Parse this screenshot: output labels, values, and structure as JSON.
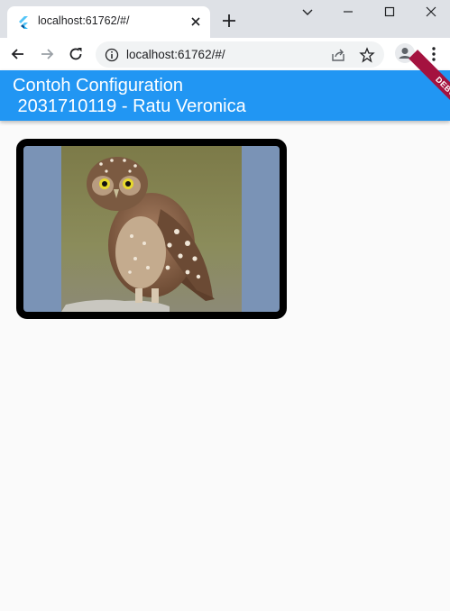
{
  "browser": {
    "tab_title": "localhost:61762/#/",
    "url": "localhost:61762/#/",
    "icons": [
      "flutter-favicon",
      "close-icon",
      "new-tab-icon",
      "chevron-down-icon",
      "minimize-icon",
      "maximize-icon",
      "close-window-icon",
      "back-arrow-icon",
      "forward-arrow-icon",
      "reload-icon",
      "info-icon",
      "share-icon",
      "star-icon",
      "profile-icon",
      "kebab-menu-icon"
    ]
  },
  "app": {
    "title_line1": "Contoh Configuration",
    "title_line2": " 2031710119 - Ratu Veronica",
    "debug_banner": "DEBUG",
    "colors": {
      "appbar": "#2196f3",
      "background": "#fafafa",
      "image_frame_border": "#000000",
      "image_frame_background": "#7a93b6",
      "debug_banner": "#a4123f"
    },
    "image": {
      "subject": "owl photo"
    }
  }
}
